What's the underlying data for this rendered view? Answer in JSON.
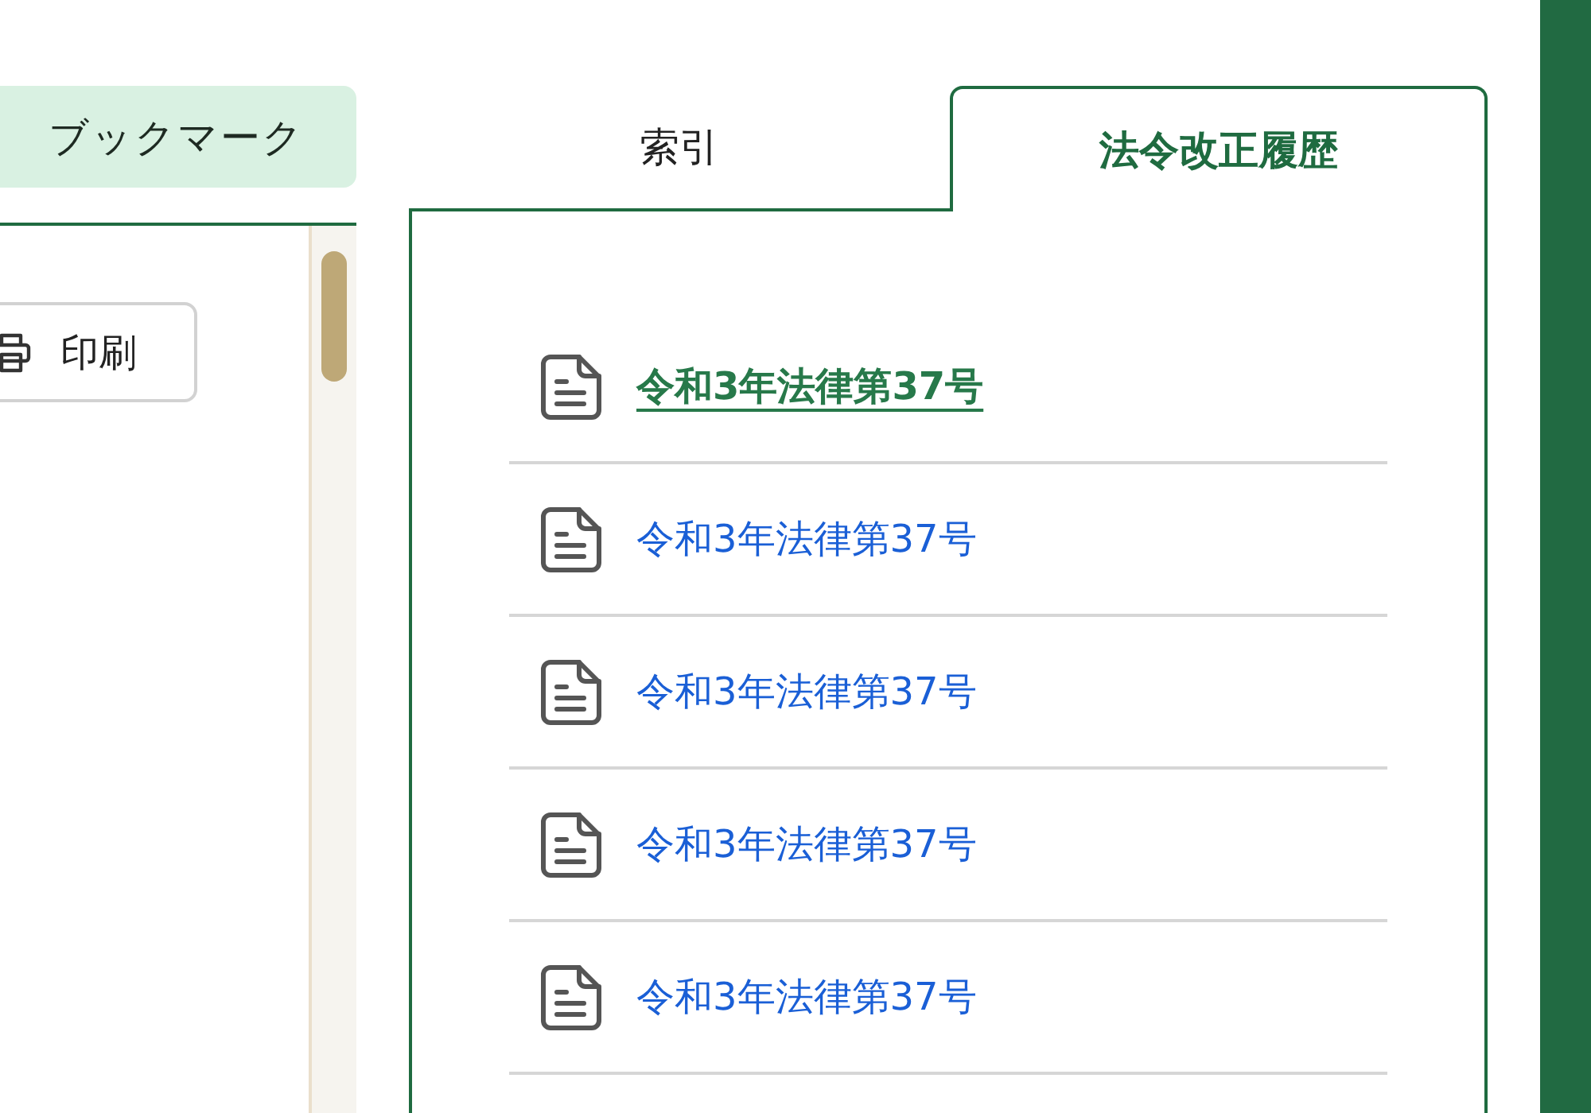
{
  "bookmark_button": {
    "label": "ブックマーク"
  },
  "print_button": {
    "label": "印刷"
  },
  "tabs": [
    {
      "label": "索引",
      "selected": false
    },
    {
      "label": "法令改正履歴",
      "selected": true
    }
  ],
  "amendment_history": [
    {
      "label": "令和3年法律第37号",
      "selected": true
    },
    {
      "label": "令和3年法律第37号",
      "selected": false
    },
    {
      "label": "令和3年法律第37号",
      "selected": false
    },
    {
      "label": "令和3年法律第37号",
      "selected": false
    },
    {
      "label": "令和3年法律第37号",
      "selected": false
    }
  ]
}
